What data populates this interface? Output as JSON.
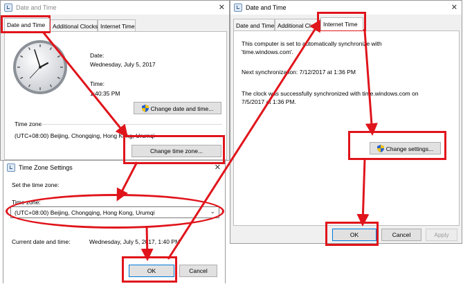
{
  "left_window": {
    "title": "Date and Time",
    "tabs": [
      "Date and Time",
      "Additional Clocks",
      "Internet Time"
    ],
    "date_label": "Date:",
    "date_value": "Wednesday, July 5, 2017",
    "time_label": "Time:",
    "time_value": "1:40:35 PM",
    "change_date_button": "Change date and time...",
    "time_zone_label": "Time zone",
    "time_zone_value": "(UTC+08:00) Beijing, Chongqing, Hong Kong, Urumqi",
    "change_zone_button": "Change time zone..."
  },
  "tz_dialog": {
    "title": "Time Zone Settings",
    "set_label": "Set the time zone:",
    "zone_label": "Time zone:",
    "zone_value": "(UTC+08:00) Beijing, Chongqing, Hong Kong, Urumqi",
    "current_label": "Current date and time:",
    "current_value": "Wednesday, July 5, 2017, 1:40 PM",
    "ok": "OK",
    "cancel": "Cancel"
  },
  "right_window": {
    "title": "Date and Time",
    "tabs": [
      "Date and Time",
      "Additional Clocks",
      "Internet Time"
    ],
    "sync_line1": "This computer is set to automatically synchronize with",
    "sync_line2": "'time.windows.com'.",
    "next_sync": "Next synchronization: 7/12/2017 at 1:36 PM",
    "success_line1": "The clock was successfully synchronized with time.windows.com on",
    "success_line2": "7/5/2017 at 1:36 PM.",
    "change_settings_button": "Change settings...",
    "ok": "OK",
    "cancel": "Cancel",
    "apply": "Apply"
  },
  "colors": {
    "highlight_red": "#e0141b",
    "accent_blue": "#0078d7"
  },
  "icons": [
    "clock-icon",
    "shield-icon",
    "close-icon",
    "chevron-down-icon",
    "window-icon"
  ]
}
